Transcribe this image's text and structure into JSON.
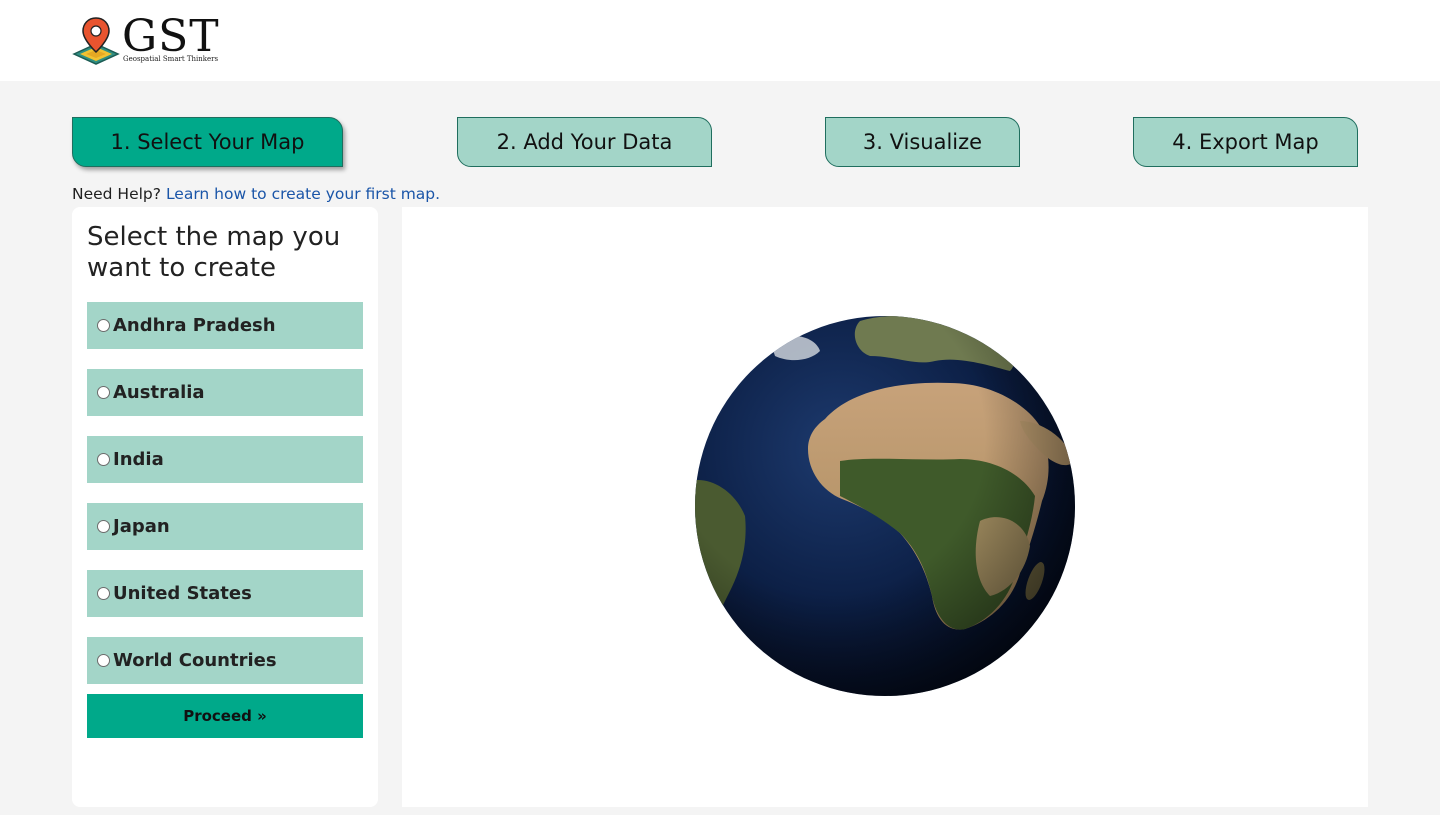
{
  "logo": {
    "icon": "map-pin-icon",
    "wordmark": "GST",
    "tagline": "Geospatial Smart Thinkers"
  },
  "steps": [
    {
      "label": "1. Select Your Map",
      "active": true
    },
    {
      "label": "2. Add Your Data",
      "active": false
    },
    {
      "label": "3. Visualize",
      "active": false
    },
    {
      "label": "4. Export Map",
      "active": false
    }
  ],
  "help": {
    "prefix": "Need Help?",
    "link": "Learn how to create your first map."
  },
  "panel": {
    "title": "Select the map you want to create",
    "options": [
      {
        "label": "Andhra Pradesh",
        "selected": false
      },
      {
        "label": "Australia",
        "selected": false
      },
      {
        "label": "India",
        "selected": false
      },
      {
        "label": "Japan",
        "selected": false
      },
      {
        "label": "United States",
        "selected": false
      },
      {
        "label": "World Countries",
        "selected": false
      }
    ],
    "proceed_label": "Proceed »"
  },
  "globe": {
    "icon": "earth-globe-icon"
  },
  "colors": {
    "accent": "#00a98a",
    "accent_light": "#a3d5c8",
    "link": "#1a55a8",
    "background": "#f4f4f4"
  }
}
